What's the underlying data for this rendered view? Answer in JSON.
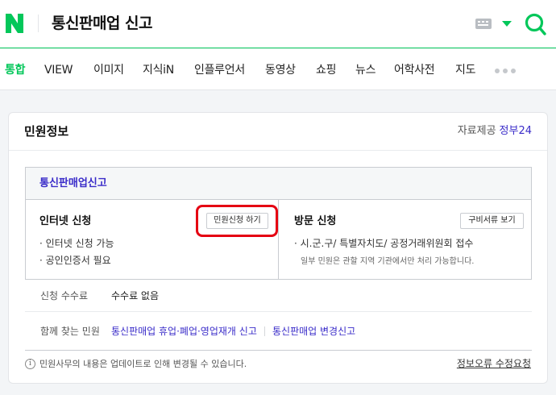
{
  "header": {
    "logo_icon": "naver-n-logo",
    "query": "통신판매업 신고",
    "keyboard_icon": "keyboard-icon",
    "dropdown_icon": "caret-down-icon",
    "search_icon": "search-icon",
    "accent_color": "#03c75a"
  },
  "tabs": [
    {
      "label": "통합",
      "active": true
    },
    {
      "label": "VIEW"
    },
    {
      "label": "이미지"
    },
    {
      "label": "지식iN"
    },
    {
      "label": "인플루언서"
    },
    {
      "label": "동영상"
    },
    {
      "label": "쇼핑"
    },
    {
      "label": "뉴스"
    },
    {
      "label": "어학사전"
    },
    {
      "label": "지도"
    }
  ],
  "more_icon": "more-dots-icon",
  "card": {
    "title": "민원정보",
    "provider_label": "자료제공",
    "provider_name": "정부24",
    "box_title": "통신판매업신고",
    "online": {
      "title": "인터넷 신청",
      "button": "민원신청 하기",
      "bullets": [
        "· 인터넷 신청 가능",
        "· 공인인증서 필요"
      ]
    },
    "visit": {
      "title": "방문 신청",
      "button": "구비서류 보기",
      "bullets": [
        "· 시.군.구/ 특별자치도/ 공정거래위원회 접수"
      ],
      "note": "일부 민원은 관할 지역 기관에서만 처리 가능합니다."
    },
    "fee": {
      "label": "신청 수수료",
      "value": "수수료 없음"
    },
    "related": {
      "label": "함께 찾는 민원",
      "links": [
        "통신판매업 휴업·폐업·영업재개 신고",
        "통신판매업 변경신고"
      ]
    },
    "footer": {
      "info_icon": "info-icon",
      "notice": "민원사무의 내용은 업데이트로 인해 변경될 수 있습니다.",
      "report_link": "정보오류 수정요청"
    },
    "link_color": "#3a2cc9",
    "highlight_color": "#e50012"
  }
}
